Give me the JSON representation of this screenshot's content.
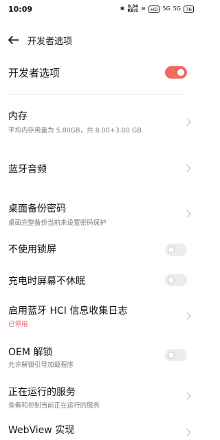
{
  "status": {
    "time": "10:09",
    "bluetooth": "✱",
    "speed_value": "0.34",
    "speed_unit": "KB/S",
    "wifi": "≋",
    "hd": "HD",
    "signal1": "5G",
    "signal2": "5G",
    "battery": "76"
  },
  "header": {
    "back_icon": "arrow-left-icon",
    "title": "开发者选项"
  },
  "master": {
    "title": "开发者选项",
    "enabled": true
  },
  "items": [
    {
      "title": "内存",
      "subtitle": "平均内存用量为 5.80GB，共 8.00+3.00 GB",
      "control": "chevron"
    },
    {
      "title": "蓝牙音频",
      "subtitle": "",
      "control": "chevron"
    },
    {
      "title": "桌面备份密码",
      "subtitle": "桌面完整备份当前未设置密码保护",
      "control": "chevron"
    },
    {
      "title": "不使用锁屏",
      "subtitle": "",
      "control": "toggle",
      "enabled": false
    },
    {
      "title": "充电时屏幕不休眠",
      "subtitle": "",
      "control": "toggle",
      "enabled": false
    },
    {
      "title": "启用蓝牙 HCI 信息收集日志",
      "subtitle": "已停用",
      "subtitle_color": "#e2625b",
      "control": "chevron"
    },
    {
      "title": "OEM 解锁",
      "subtitle": "允许解锁引导加载程序",
      "control": "toggle",
      "enabled": false
    },
    {
      "title": "正在运行的服务",
      "subtitle": "查看和控制当前正在运行的服务",
      "control": "chevron"
    },
    {
      "title": "WebView 实现",
      "subtitle": "",
      "control": "chevron"
    }
  ],
  "colors": {
    "accent": "#ee6b5e",
    "disabled_red": "#e2625b",
    "subtitle_gray": "#7d7d7d"
  }
}
